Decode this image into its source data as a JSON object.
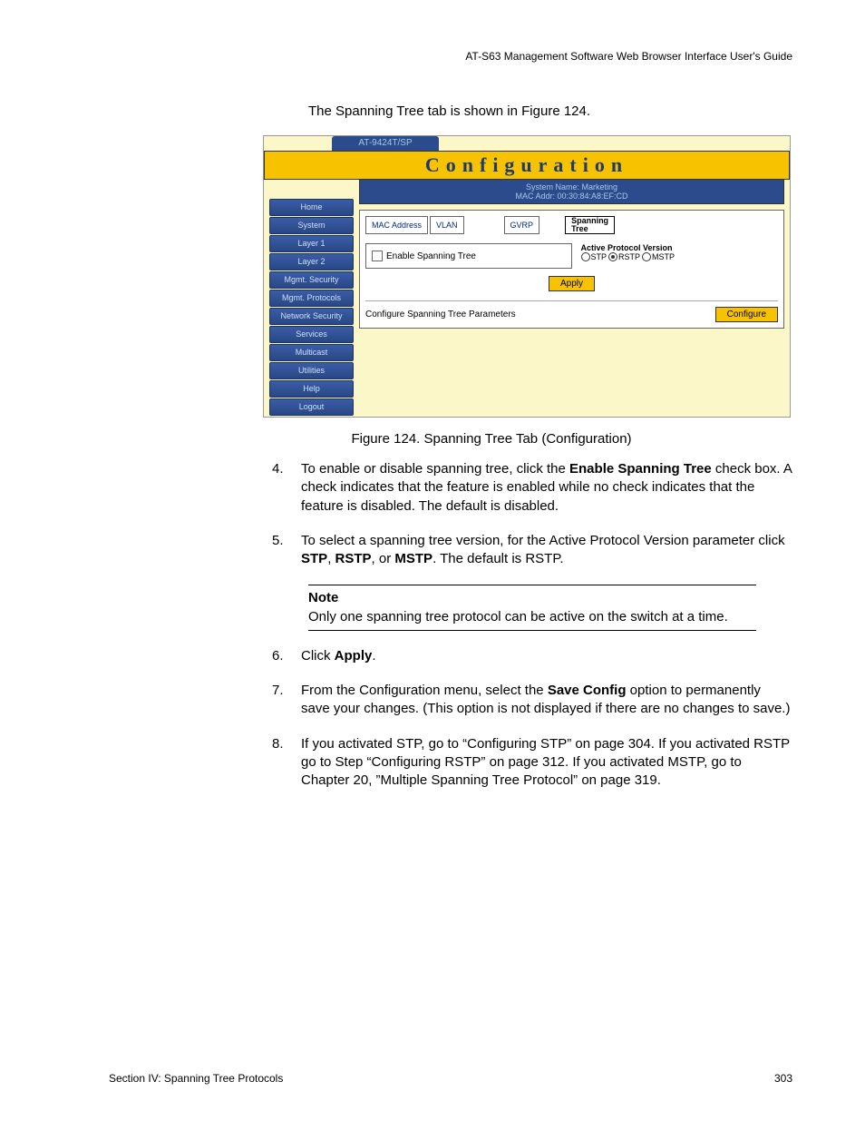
{
  "header": "AT-S63 Management Software Web Browser Interface User's Guide",
  "intro": "The Spanning Tree tab is shown in Figure 124.",
  "ui": {
    "model": "AT-9424T/SP",
    "title": "Configuration",
    "sysName": "System Name: Marketing",
    "macAddr": "MAC Addr: 00:30:84:A8:EF:CD",
    "sidebar": [
      "Home",
      "System",
      "Layer 1",
      "Layer 2",
      "Mgmt. Security",
      "Mgmt. Protocols",
      "Network Security",
      "Services",
      "Multicast",
      "Utilities",
      "Help",
      "Logout"
    ],
    "tabs": {
      "mac": "MAC Address",
      "vlan": "VLAN",
      "gvrp": "GVRP",
      "stree": "Spanning\nTree"
    },
    "enableLabel": "Enable Spanning Tree",
    "protoTitle": "Active Protocol Version",
    "protoOpts": {
      "stp": "STP",
      "rstp": "RSTP",
      "mstp": "MSTP"
    },
    "applyBtn": "Apply",
    "cfgLabel": "Configure Spanning Tree Parameters",
    "cfgBtn": "Configure"
  },
  "caption": "Figure 124. Spanning Tree Tab (Configuration)",
  "steps": {
    "s4": {
      "n": "4.",
      "a": "To enable or disable spanning tree, click the ",
      "b": "Enable Spanning Tree",
      "c": " check box. A check indicates that the feature is enabled while no check indicates that the feature is disabled. The default is disabled."
    },
    "s5": {
      "n": "5.",
      "a": "To select a spanning tree version, for the Active Protocol Version parameter click ",
      "b": "STP",
      "c": ", ",
      "d": "RSTP",
      "e": ", or ",
      "f": "MSTP",
      "g": ". The default is RSTP."
    },
    "note": {
      "title": "Note",
      "body": "Only one spanning tree protocol can be active on the switch at a time."
    },
    "s6": {
      "n": "6.",
      "a": "Click ",
      "b": "Apply",
      "c": "."
    },
    "s7": {
      "n": "7.",
      "a": "From the Configuration menu, select the ",
      "b": "Save Config",
      "c": " option to permanently save your changes. (This option is not displayed if there are no changes to save.)"
    },
    "s8": {
      "n": "8.",
      "a": "If you activated STP, go to “Configuring STP” on page 304. If you activated RSTP go to Step “Configuring RSTP” on page 312. If you activated MSTP, go to Chapter 20, ”Multiple Spanning Tree Protocol” on page 319."
    }
  },
  "footer": {
    "left": "Section IV: Spanning Tree Protocols",
    "right": "303"
  }
}
